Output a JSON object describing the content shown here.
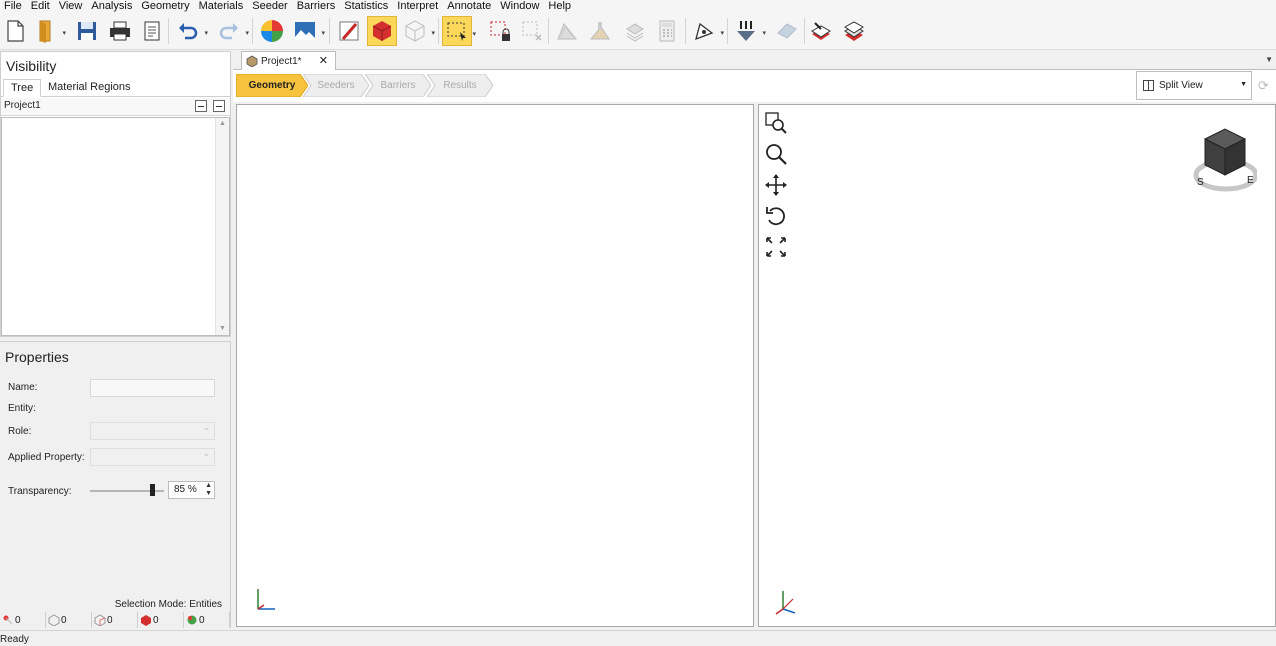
{
  "menu": [
    "File",
    "Edit",
    "View",
    "Analysis",
    "Geometry",
    "Materials",
    "Seeder",
    "Barriers",
    "Statistics",
    "Interpret",
    "Annotate",
    "Window",
    "Help"
  ],
  "visibility": {
    "title": "Visibility",
    "tabs": [
      "Tree",
      "Material Regions"
    ],
    "tree_root": "Project1"
  },
  "properties": {
    "title": "Properties",
    "name_label": "Name:",
    "entity_label": "Entity:",
    "role_label": "Role:",
    "applied_property_label": "Applied Property:",
    "transparency_label": "Transparency:",
    "transparency_value": "85 %",
    "transparency_fraction": 0.85
  },
  "selection_mode": "Selection Mode: Entities",
  "counters": [
    "0",
    "0",
    "0",
    "0",
    "0"
  ],
  "document": {
    "tab_label": "Project1*",
    "close_glyph": "✕"
  },
  "workflow": {
    "steps": [
      "Geometry",
      "Seeders",
      "Barriers",
      "Results"
    ],
    "active": "Geometry"
  },
  "view_mode": "Split View",
  "status": "Ready",
  "colors": {
    "accent_yellow": "#fcd85a",
    "workflow_active": "#f7c33f",
    "workflow_inactive": "#eeeeee",
    "red_box": "#d32f2f"
  },
  "icons": {
    "toolbar": [
      "new-file-icon",
      "open-folder-icon",
      "save-icon",
      "print-icon",
      "report-icon",
      "undo-icon",
      "redo-icon",
      "color-wheel-icon",
      "image-export-icon",
      "edit-tool-icon",
      "red-box-icon",
      "wireframe-box-icon",
      "box-select-icon",
      "lock-select-icon",
      "clear-select-icon",
      "surface-icon",
      "surface-edit-icon",
      "layer-icon",
      "calculator-icon",
      "pen-tool-icon",
      "seeder-icon",
      "barrier-icon",
      "compute-icon",
      "compute-all-icon"
    ],
    "nav": [
      "zoom-window-icon",
      "zoom-icon",
      "pan-icon",
      "rotate-icon",
      "fit-view-icon"
    ]
  }
}
